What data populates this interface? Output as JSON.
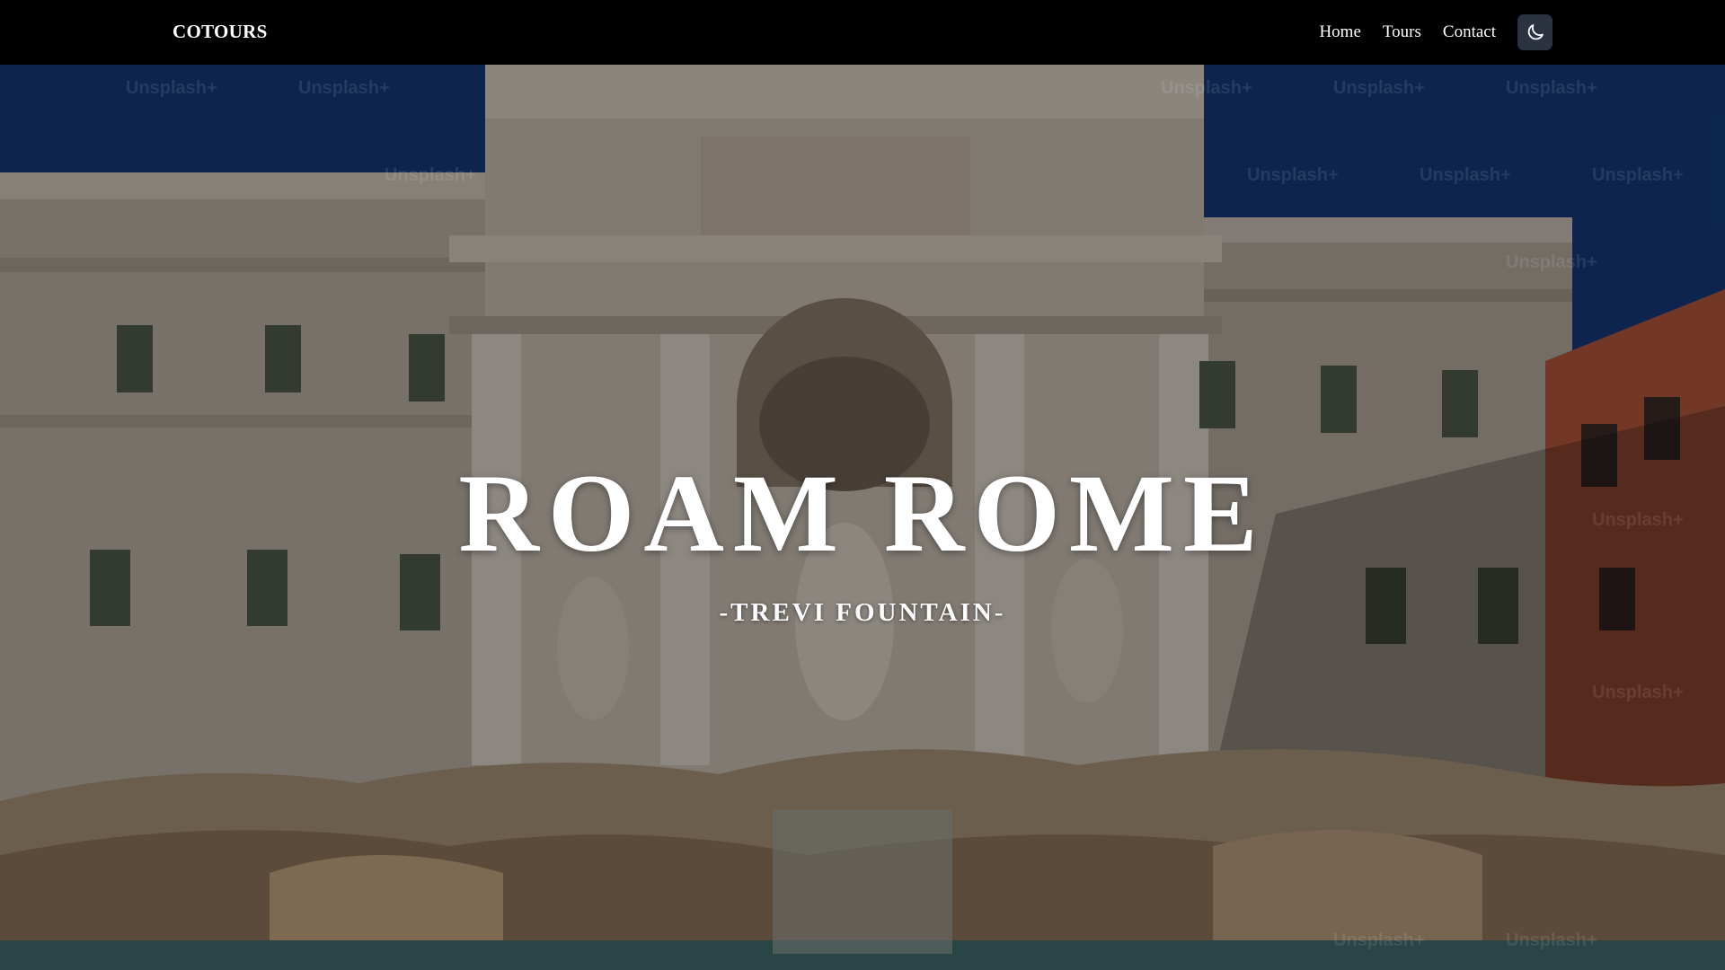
{
  "navbar": {
    "brand": "COTOURS",
    "links": [
      {
        "label": "Home"
      },
      {
        "label": "Tours"
      },
      {
        "label": "Contact"
      }
    ],
    "theme_toggle_icon": "moon-icon"
  },
  "hero": {
    "title": "ROAM ROME",
    "subtitle": "-TREVI FOUNTAIN-",
    "watermark_text": "Unsplash+"
  },
  "colors": {
    "navbar_bg": "#000000",
    "toggle_bg": "#2b3340",
    "text": "#ffffff"
  }
}
